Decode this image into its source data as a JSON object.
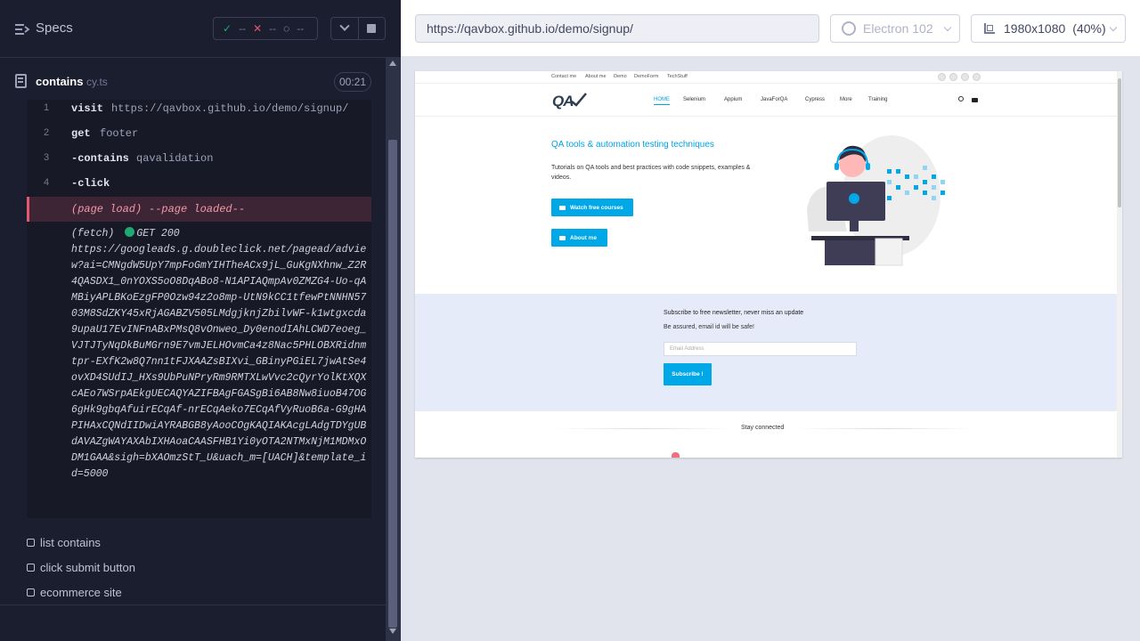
{
  "runner": {
    "header": {
      "title": "Specs",
      "stats": {
        "passed": "--",
        "failed": "--",
        "pending": "--"
      }
    },
    "spec": {
      "name": "contains",
      "ext": "cy.ts",
      "timer": "00:21"
    },
    "commands": [
      {
        "num": "1",
        "name": "visit",
        "arg": "https://qavbox.github.io/demo/signup/"
      },
      {
        "num": "2",
        "name": "get",
        "arg": "footer"
      },
      {
        "num": "3",
        "name": "-contains",
        "arg": "qavalidation"
      },
      {
        "num": "4",
        "name": "-click",
        "arg": ""
      }
    ],
    "page_load": {
      "name": "(page load)",
      "arg": "--page loaded--"
    },
    "fetch": {
      "label": "(fetch)",
      "status": "GET 200",
      "url": "https://googleads.g.doubleclick.net/pagead/adview?ai=CMNgdW5UpY7mpFoGmYIHTheACx9jL_GuKgNXhnw_Z2R4QASDX1_0nYOXS5oO8DqABo8-N1APIAQmpAv0ZMZG4-Uo-qAMBiyAPLBKoEzgFP0Ozw94z2o8mp-UtN9kCC1tfewPtNNHN5703M8SdZKY45xRjAGABZV505LMdgjknjZbilvWF-k1wtgxcda9upaU17EvINFnABxPMsQ8vOnweo_Dy0enodIAhLCWD7eoeg_VJTJTyNqDkBuMGrn9E7vmJELHOvmCa4z8Nac5PHLOBXRidnmtpr-EXfK2w8Q7nn1tFJXAAZsBIXvi_GBinyPGiEL7jwAtSe4ovXD4SUdIJ_HXs9UbPuNPryRm9RMTXLwVvc2cQyrYolKtXQXcAEo7WSrpAEkgUECAQYAZIFBAgFGASgBi6AB8Nw8iuoB47OG6gHk9gbqAfuirECqAf-nrECqAeko7ECqAfVyRuoB6a-G9gHAPIHAxCQNdIIDwiAYRABGB8yAooCOgKAQIAKAcgLAdgTDYgUBdAVAZgWAYAXAbIXHAoaCAASFHB1Yi0yOTA2NTMxNjM1MDMxODM1GAA&sigh=bXAOmzStT_U&uach_m=[UACH]&template_id=5000"
    },
    "pending_tests": [
      "list contains",
      "click submit button",
      "ecommerce site"
    ]
  },
  "aut": {
    "url": "https://qavbox.github.io/demo/signup/",
    "browser": "Electron 102",
    "viewport": "1980x1080",
    "scale": "(40%)"
  },
  "site": {
    "toplinks": [
      "Contact me",
      "About me",
      "Demo",
      "DemoForm",
      "TechStuff"
    ],
    "logo": "QA",
    "nav": [
      "HOME",
      "Selenium",
      "Appium",
      "JavaForQA",
      "Cypress",
      "More",
      "Training"
    ],
    "hero_title": "QA tools & automation testing techniques",
    "hero_desc": "Tutorials on QA tools and best practices with code snippets, examples & videos.",
    "btn_watch": "Watch free courses",
    "btn_about": "About me",
    "newsletter_title": "Subscribe to free newsletter, never miss an update",
    "newsletter_sub": "Be assured, email id will be safe!",
    "email_placeholder": "Email Address",
    "subscribe_btn": "Subscribe !",
    "stay_connected": "Stay connected"
  },
  "colors": {
    "runner_bg": "#1b1e2e",
    "pass": "#1fa971",
    "fail": "#e45770",
    "site_accent": "#00a3e0"
  }
}
